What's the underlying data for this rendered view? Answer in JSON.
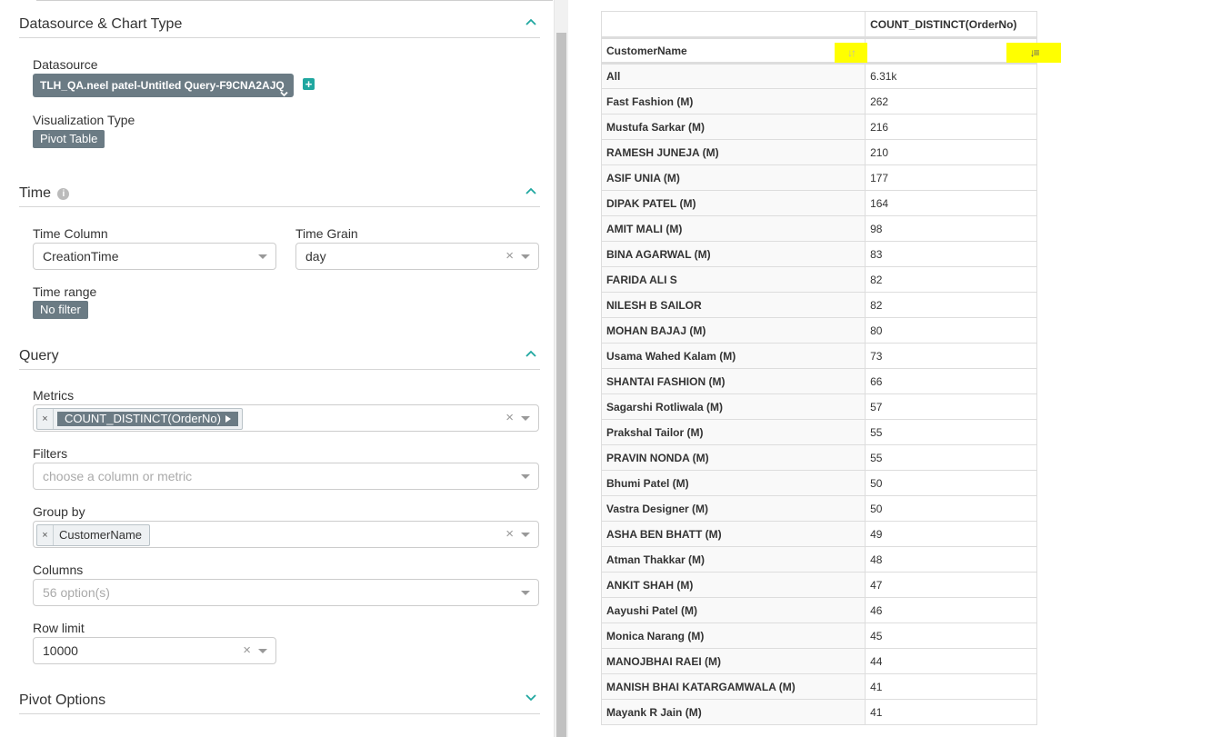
{
  "sections": {
    "datasource": {
      "title": "Datasource & Chart Type",
      "datasource_label": "Datasource",
      "datasource_value": "TLH_QA.neel patel-Untitled Query-F9CNA2AJQ",
      "viz_label": "Visualization Type",
      "viz_value": "Pivot Table"
    },
    "time": {
      "title": "Time",
      "time_column_label": "Time Column",
      "time_column_value": "CreationTime",
      "time_grain_label": "Time Grain",
      "time_grain_value": "day",
      "time_range_label": "Time range",
      "time_range_value": "No filter"
    },
    "query": {
      "title": "Query",
      "metrics_label": "Metrics",
      "metrics_value": "COUNT_DISTINCT(OrderNo)",
      "filters_label": "Filters",
      "filters_placeholder": "choose a column or metric",
      "groupby_label": "Group by",
      "groupby_value": "CustomerName",
      "columns_label": "Columns",
      "columns_placeholder": "56 option(s)",
      "rowlimit_label": "Row limit",
      "rowlimit_value": "10000"
    },
    "pivot_options": {
      "title": "Pivot Options"
    }
  },
  "icons": {
    "clear": "×",
    "tag_remove": "×",
    "add": "+"
  },
  "pivot": {
    "metric_header": "COUNT_DISTINCT(OrderNo)",
    "row_header": "CustomerName",
    "rows": [
      {
        "name": "All",
        "value": "6.31k"
      },
      {
        "name": "Fast Fashion (M)",
        "value": "262"
      },
      {
        "name": "Mustufa Sarkar (M)",
        "value": "216"
      },
      {
        "name": "RAMESH JUNEJA (M)",
        "value": "210"
      },
      {
        "name": "ASIF UNIA (M)",
        "value": "177"
      },
      {
        "name": "DIPAK PATEL (M)",
        "value": "164"
      },
      {
        "name": "AMIT MALI (M)",
        "value": "98"
      },
      {
        "name": "BINA AGARWAL (M)",
        "value": "83"
      },
      {
        "name": "FARIDA ALI S",
        "value": "82"
      },
      {
        "name": "NILESH B SAILOR",
        "value": "82"
      },
      {
        "name": "MOHAN BAJAJ (M)",
        "value": "80"
      },
      {
        "name": "Usama Wahed Kalam (M)",
        "value": "73"
      },
      {
        "name": "SHANTAI FASHION (M)",
        "value": "66"
      },
      {
        "name": "Sagarshi Rotliwala (M)",
        "value": "57"
      },
      {
        "name": "Prakshal Tailor (M)",
        "value": "55"
      },
      {
        "name": "PRAVIN NONDA (M)",
        "value": "55"
      },
      {
        "name": "Bhumi Patel (M)",
        "value": "50"
      },
      {
        "name": "Vastra Designer (M)",
        "value": "50"
      },
      {
        "name": "ASHA BEN BHATT (M)",
        "value": "49"
      },
      {
        "name": "Atman Thakkar (M)",
        "value": "48"
      },
      {
        "name": "ANKIT SHAH (M)",
        "value": "47"
      },
      {
        "name": "Aayushi Patel (M)",
        "value": "46"
      },
      {
        "name": "Monica Narang (M)",
        "value": "45"
      },
      {
        "name": "MANOJBHAI RAEI (M)",
        "value": "44"
      },
      {
        "name": "MANISH BHAI KATARGAMWALA (M)",
        "value": "41"
      },
      {
        "name": "Mayank R Jain (M)",
        "value": "41"
      }
    ]
  }
}
